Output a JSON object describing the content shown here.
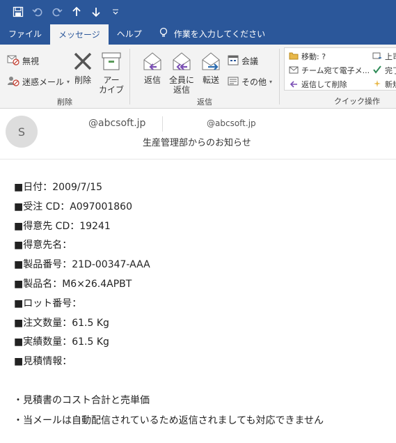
{
  "titlebar": {
    "icons": [
      "save-icon",
      "undo-icon",
      "redo-icon",
      "up-arrow-icon",
      "down-arrow-icon",
      "customize-icon"
    ]
  },
  "tabs": [
    {
      "label": "ファイル"
    },
    {
      "label": "メッセージ"
    },
    {
      "label": "ヘルプ"
    }
  ],
  "tellme": {
    "label": "作業を入力してください"
  },
  "ribbon": {
    "delete_group": {
      "ignore": "無視",
      "junk": "迷惑メール",
      "delete": "削除",
      "archive_line1": "アー",
      "archive_line2": "カイブ",
      "label": "削除"
    },
    "reply_group": {
      "reply": "返信",
      "reply_all_line1": "全員に",
      "reply_all_line2": "返信",
      "forward": "転送",
      "meeting": "会議",
      "more": "その他",
      "label": "返信"
    },
    "quick_steps": {
      "move_to": "移動: ?",
      "team_email": "チーム宛て電子メ...",
      "reply_delete": "返信して削除",
      "to_manager": "上司",
      "done": "完了",
      "create_new": "新規",
      "label": "クイック操作"
    }
  },
  "mail": {
    "avatar_initial": "S",
    "from_primary": "@abcsoft.jp",
    "from_secondary": "@abcsoft.jp",
    "subject": "生産管理部からのお知らせ",
    "lines": [
      "■日付：2009/7/15",
      "■受注 CD：A097001860",
      "■得意先 CD：19241",
      "■得意先名：",
      "■製品番号：21D-00347-AAA",
      "■製品名：M6×26.4APBT",
      "■ロット番号：",
      "■注文数量：61.5 Kg",
      "■実績数量：61.5 Kg",
      "■見積情報："
    ],
    "notes": [
      "・見積書のコスト合計と売単価",
      "・当メールは自動配信されているため返信されましても対応できません"
    ]
  },
  "colors": {
    "accent": "#2b579a",
    "ribbon_bg": "#f3f3f3",
    "reply_arrow": "#7b4fb5"
  }
}
